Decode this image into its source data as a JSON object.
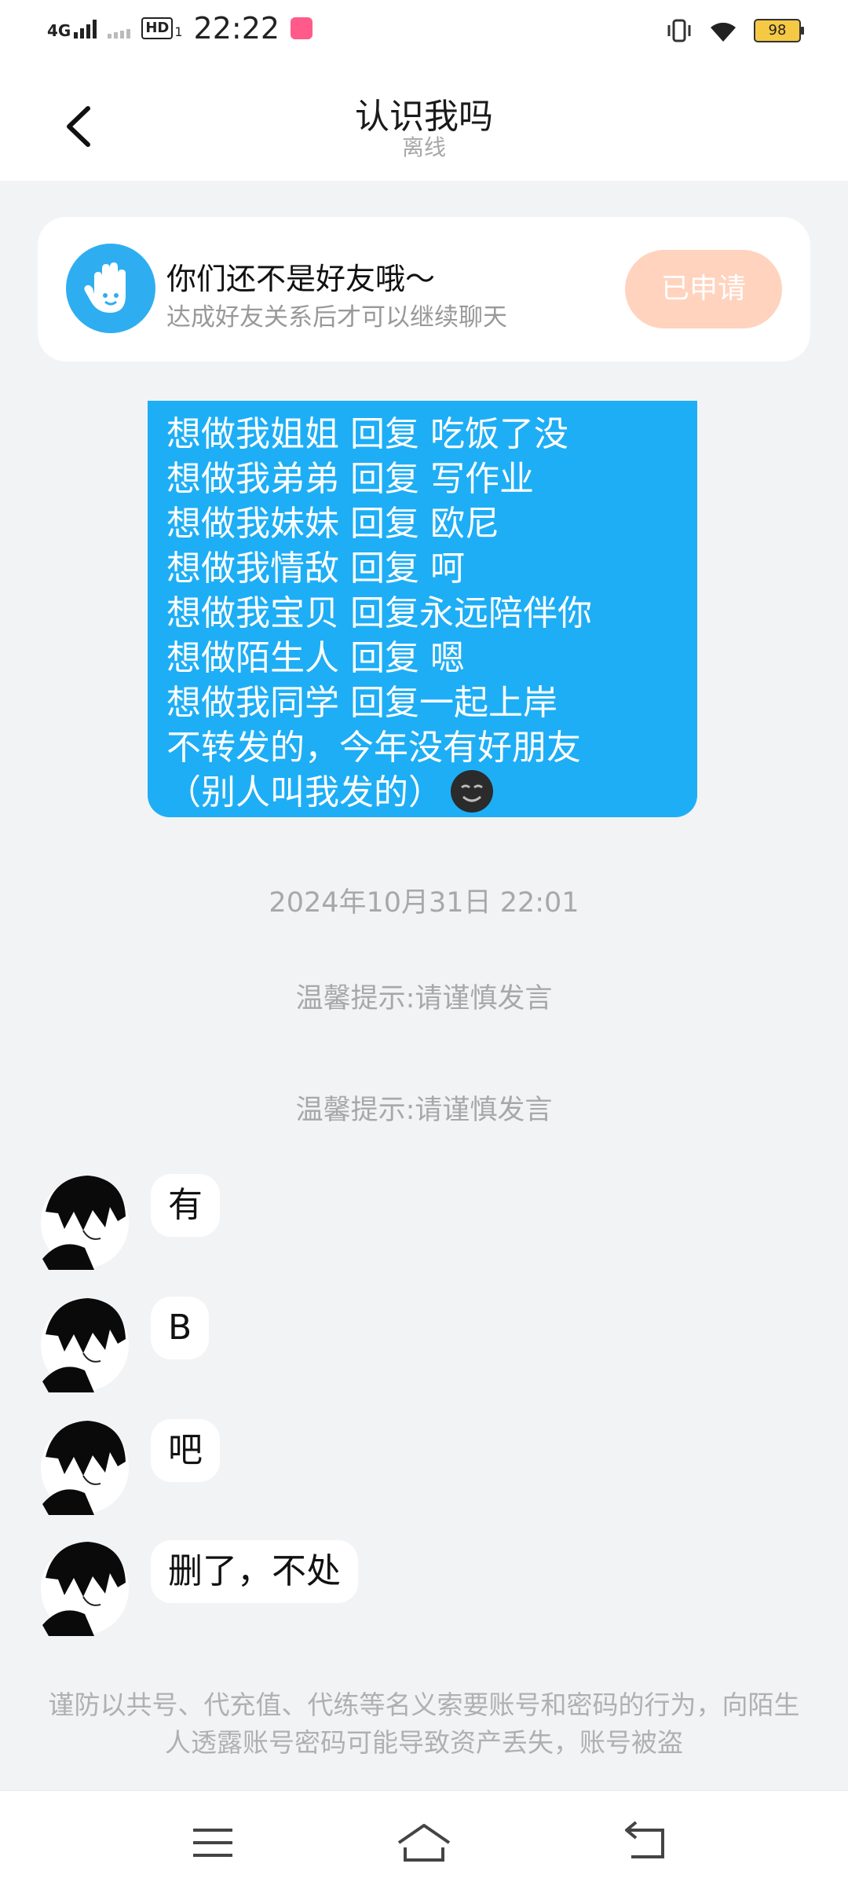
{
  "status_bar": {
    "network": "4G",
    "hd": "HD",
    "sim": "1",
    "time": "22:22",
    "battery": "98"
  },
  "header": {
    "title": "认识我吗",
    "subtitle": "离线"
  },
  "friend_card": {
    "title": "你们还不是好友哦～",
    "subtitle": "达成好友关系后才可以继续聊天",
    "button": "已申请"
  },
  "sent_message": {
    "lines": [
      "想做我姐姐 回复 吃饭了没",
      "想做我弟弟 回复 写作业",
      "想做我妹妹 回复 欧尼",
      "想做我情敌 回复 呵",
      "想做我宝贝 回复永远陪伴你",
      "想做陌生人 回复 嗯",
      "想做我同学 回复一起上岸",
      "不转发的，今年没有好朋友",
      "（别人叫我发的）"
    ]
  },
  "system": {
    "timestamp": "2024年10月31日 22:01",
    "tip1": "温馨提示:请谨慎发言",
    "tip2": "温馨提示:请谨慎发言"
  },
  "received": [
    {
      "text": "有"
    },
    {
      "text": "B"
    },
    {
      "text": "吧"
    },
    {
      "text": "删了，不处"
    }
  ],
  "warning": "谨防以共号、代充值、代练等名义索要账号和密码的行为，向陌生人透露账号密码可能导致资产丢失，账号被盗",
  "colors": {
    "accent": "#1eaef5",
    "applied_button": "#ffd3bd",
    "background": "#f2f3f5"
  },
  "icons": [
    "back-arrow-icon",
    "hand-wave-icon",
    "smiling-dark-face-emoji",
    "menu-icon",
    "home-icon",
    "back-return-icon",
    "vibrate-icon",
    "wifi-icon",
    "battery-icon"
  ]
}
